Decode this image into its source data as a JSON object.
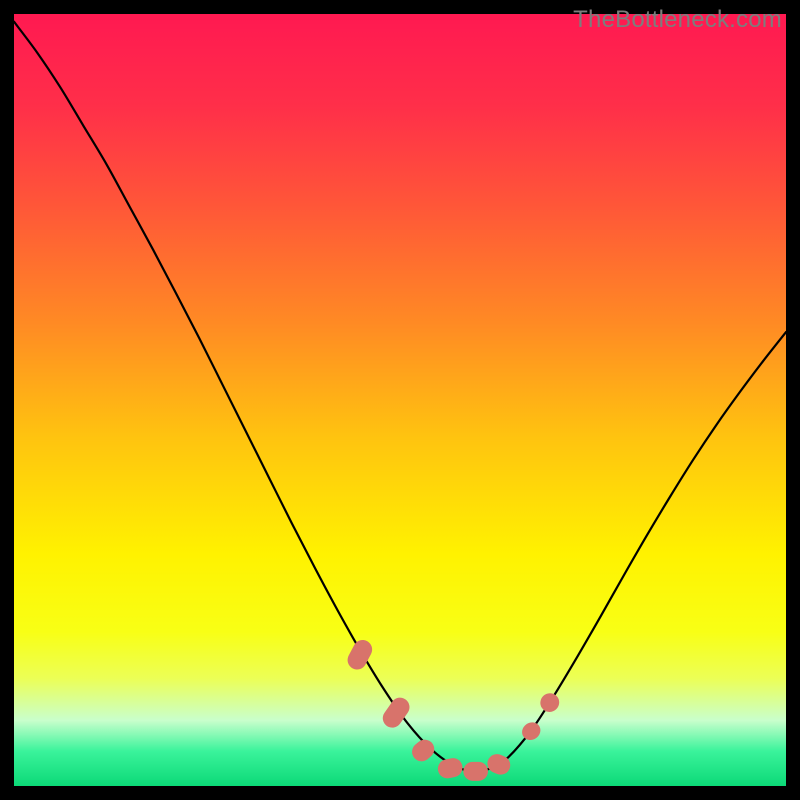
{
  "attribution": "TheBottleneck.com",
  "chart_data": {
    "type": "line",
    "title": "",
    "xlabel": "",
    "ylabel": "",
    "xlim": [
      0,
      100
    ],
    "ylim": [
      0,
      100
    ],
    "grid": false,
    "legend": false,
    "background_gradient": {
      "stops": [
        {
          "offset": 0.0,
          "color": "#ff1951"
        },
        {
          "offset": 0.12,
          "color": "#ff2f49"
        },
        {
          "offset": 0.25,
          "color": "#ff5738"
        },
        {
          "offset": 0.4,
          "color": "#ff8a24"
        },
        {
          "offset": 0.55,
          "color": "#ffc40f"
        },
        {
          "offset": 0.7,
          "color": "#fff200"
        },
        {
          "offset": 0.8,
          "color": "#f8ff15"
        },
        {
          "offset": 0.86,
          "color": "#ecff55"
        },
        {
          "offset": 0.915,
          "color": "#c9ffcc"
        },
        {
          "offset": 0.955,
          "color": "#3af39b"
        },
        {
          "offset": 1.0,
          "color": "#0cd977"
        }
      ]
    },
    "series": [
      {
        "name": "bottleneck-curve",
        "color": "#000000",
        "stroke_width": 2.2,
        "x": [
          0,
          3,
          6,
          9,
          12,
          15,
          18,
          21,
          24,
          27,
          30,
          33,
          36,
          39,
          42,
          45,
          48,
          51,
          54,
          57,
          59,
          60.5,
          62,
          64,
          67,
          70,
          73,
          76,
          79,
          82,
          85,
          88,
          91,
          94,
          97,
          100
        ],
        "y": [
          99,
          95,
          90.5,
          85.5,
          80.5,
          75,
          69.5,
          63.8,
          58,
          52,
          46,
          40,
          34,
          28.2,
          22.6,
          17.3,
          12.4,
          8.1,
          4.8,
          2.6,
          2.0,
          2.0,
          2.4,
          3.7,
          7.2,
          11.8,
          16.8,
          22.0,
          27.3,
          32.5,
          37.5,
          42.3,
          46.8,
          51.0,
          55.0,
          58.8
        ]
      }
    ],
    "markers": {
      "name": "bottleneck-markers",
      "color": "#d8736b",
      "style": "capsule",
      "points": [
        {
          "x": 44.8,
          "y": 17.0,
          "len": 4.0,
          "angle": -62
        },
        {
          "x": 49.5,
          "y": 9.5,
          "len": 4.2,
          "angle": -55
        },
        {
          "x": 53.0,
          "y": 4.6,
          "len": 3.0,
          "angle": -40
        },
        {
          "x": 56.5,
          "y": 2.3,
          "len": 3.2,
          "angle": -12
        },
        {
          "x": 59.8,
          "y": 1.9,
          "len": 3.2,
          "angle": 0
        },
        {
          "x": 62.8,
          "y": 2.8,
          "len": 3.0,
          "angle": 22
        },
        {
          "x": 67.0,
          "y": 7.1,
          "len": 2.2,
          "angle": 54
        },
        {
          "x": 69.4,
          "y": 10.8,
          "len": 2.4,
          "angle": 56
        }
      ]
    }
  }
}
